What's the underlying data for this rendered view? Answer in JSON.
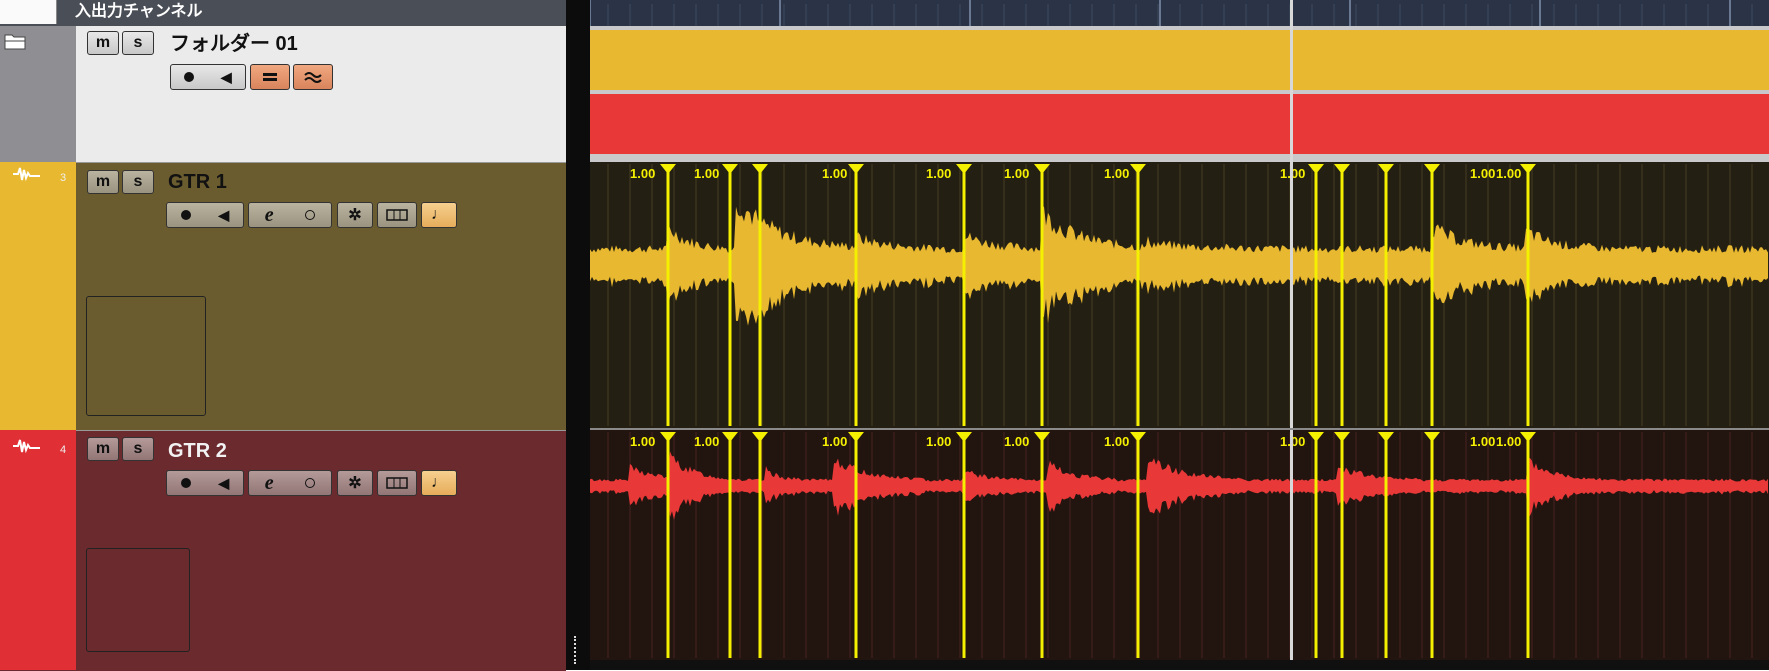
{
  "header": {
    "title": "入出力チャンネル"
  },
  "folder": {
    "name": "フォルダー 01",
    "mute": "m",
    "solo": "s"
  },
  "tracks": [
    {
      "name": "GTR 1",
      "number": "3",
      "mute": "m",
      "solo": "s",
      "color": "#e8b830",
      "panel_color": "#6b5c30",
      "wave_color": "#e8b830",
      "lane_bg": "#231f12"
    },
    {
      "name": "GTR 2",
      "number": "4",
      "mute": "m",
      "solo": "s",
      "color": "#e03035",
      "panel_color": "#6a2a2e",
      "wave_color": "#e83838",
      "lane_bg": "#22140f"
    }
  ],
  "warp_markers": {
    "label": "1.00",
    "labeled_count": 9
  },
  "colors": {
    "folder_yellow": "#e8b830",
    "folder_red": "#e83838",
    "warp_yellow": "#f5f000",
    "header_bg": "#4a4e56"
  }
}
